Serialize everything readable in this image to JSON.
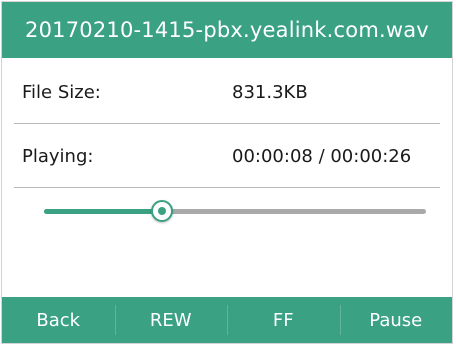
{
  "header": {
    "title": "20170210-1415-pbx.yealink.com.wav"
  },
  "details": {
    "file_size_label": "File Size:",
    "file_size_value": "831.3KB",
    "playing_label": "Playing:",
    "playing_value": "00:00:08 / 00:00:26"
  },
  "progress": {
    "fraction": 0.308
  },
  "softkeys": [
    {
      "label": "Back"
    },
    {
      "label": "REW"
    },
    {
      "label": "FF"
    },
    {
      "label": "Pause"
    }
  ],
  "colors": {
    "accent": "#3aa183",
    "track": "#a9a9a9"
  }
}
